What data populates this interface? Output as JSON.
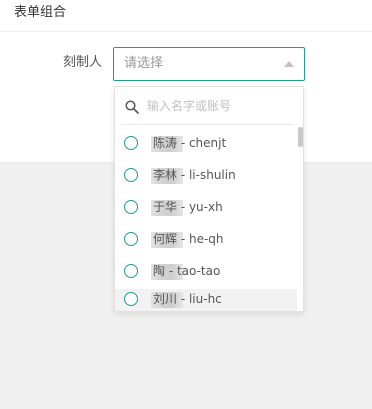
{
  "card": {
    "title": "表单组合"
  },
  "form": {
    "label": "刻制人",
    "select": {
      "placeholder": "请选择"
    }
  },
  "dropdown": {
    "search_placeholder": "输入名字或账号",
    "options": [
      {
        "label": "陈涛 - chenjt"
      },
      {
        "label": "李林 - li-shulin"
      },
      {
        "label": "于华 - yu-xh"
      },
      {
        "label": "何辉 - he-qh"
      },
      {
        "label": "陶 - tao-tao"
      },
      {
        "label": "刘川 - liu-hc"
      }
    ]
  },
  "colors": {
    "accent": "#1f9d8b"
  }
}
